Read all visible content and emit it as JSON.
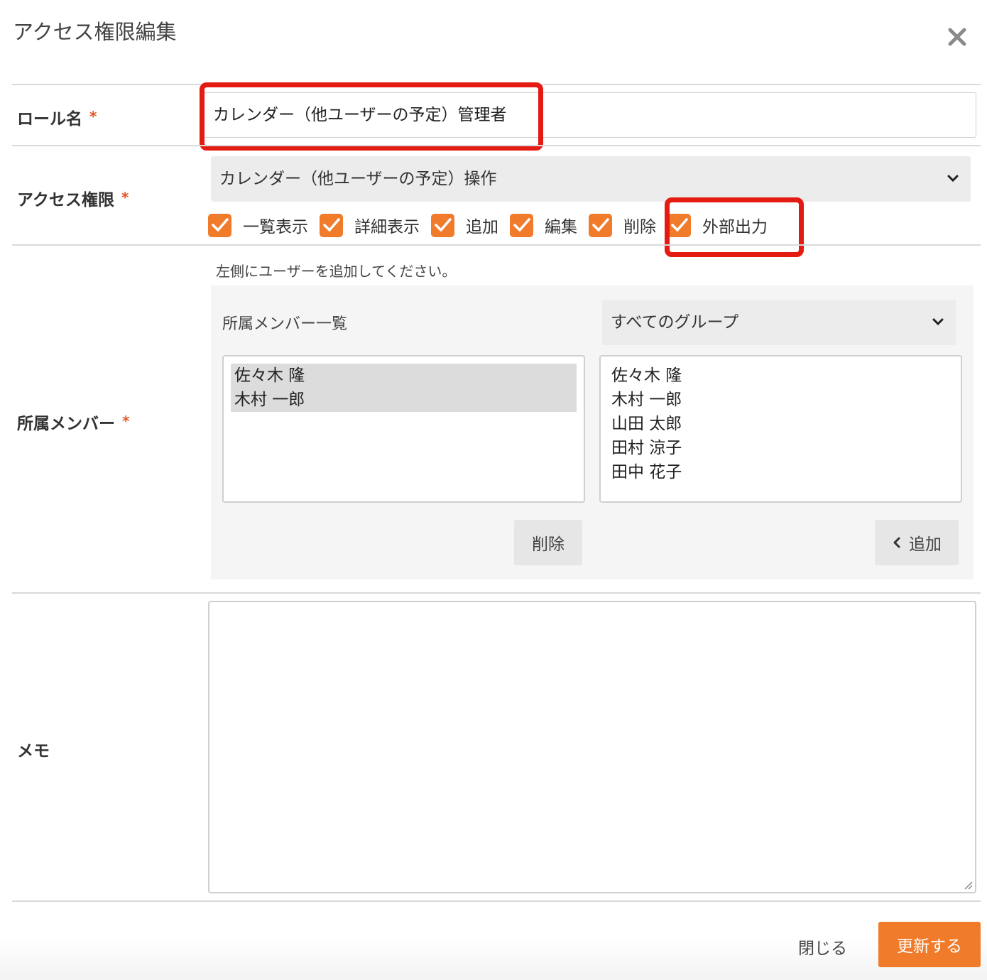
{
  "dialog": {
    "title": "アクセス権限編集",
    "close_icon": "close-icon"
  },
  "role": {
    "label": "ロール名",
    "required_mark": "*",
    "value": "カレンダー（他ユーザーの予定）管理者"
  },
  "access": {
    "label": "アクセス権限",
    "required_mark": "*",
    "selected": "カレンダー（他ユーザーの予定）操作",
    "permissions": [
      {
        "label": "一覧表示",
        "checked": true
      },
      {
        "label": "詳細表示",
        "checked": true
      },
      {
        "label": "追加",
        "checked": true
      },
      {
        "label": "編集",
        "checked": true
      },
      {
        "label": "削除",
        "checked": true
      },
      {
        "label": "外部出力",
        "checked": true
      }
    ]
  },
  "members": {
    "label": "所属メンバー",
    "required_mark": "*",
    "hint": "左側にユーザーを追加してください。",
    "list_title": "所属メンバー一覧",
    "group_select": "すべてのグループ",
    "assigned": [
      "佐々木 隆",
      "木村 一郎"
    ],
    "available": [
      "佐々木 隆",
      "木村 一郎",
      "山田 太郎",
      "田村 涼子",
      "田中 花子"
    ],
    "remove_label": "削除",
    "add_label": "追加"
  },
  "memo": {
    "label": "メモ",
    "value": ""
  },
  "footer": {
    "close_label": "閉じる",
    "update_label": "更新する"
  },
  "colors": {
    "accent": "#f07b2b",
    "required": "#e5562a",
    "annotation": "#e41b13"
  }
}
